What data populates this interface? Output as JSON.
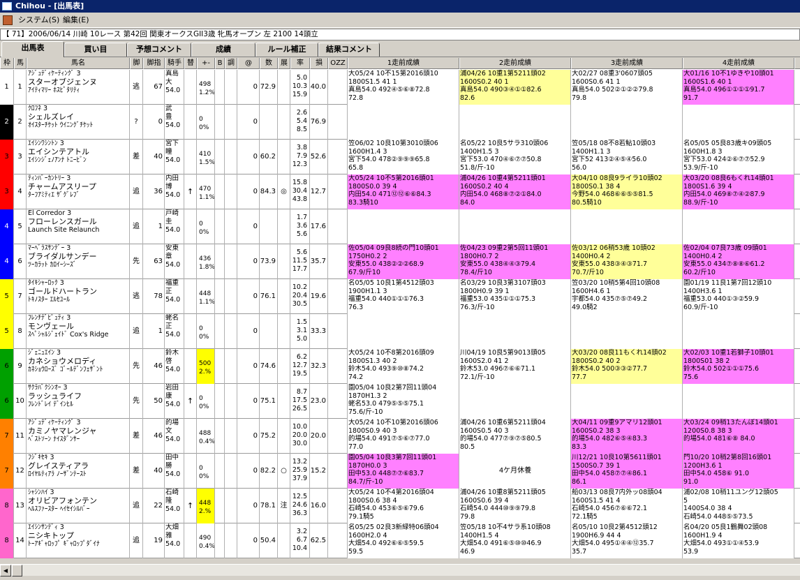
{
  "window": {
    "title": "Chihou - [出馬表]"
  },
  "menu": [
    "システム(S)",
    "編集(E)"
  ],
  "race_info": "【 71】2006/06/14 川崎 10レース 第42回 関東オークスGII3歳 牝馬オープン 左 2100 14頭立",
  "tabs": [
    "出馬表",
    "買い目",
    "予想コメント",
    "成績",
    "ルール補正",
    "結果コメント"
  ],
  "active_tab": "出馬表",
  "headers": [
    "枠",
    "馬",
    "馬名",
    "脚",
    "脚指",
    "騎手",
    "替",
    "+-",
    "B",
    "調",
    "@",
    "数",
    "展",
    "率",
    "損",
    "OZZ",
    "1走前成績",
    "2走前成績",
    "3走前成績",
    "4走前成績"
  ],
  "colors": {
    "waku1": "#ffffff",
    "waku2": "#000000",
    "waku3": "#ff0000",
    "waku4": "#0000ff",
    "waku5": "#ffff00",
    "waku6": "#00a000",
    "waku7": "#ff8000",
    "waku8": "#ff66cc",
    "pink": "#ff80ff",
    "yellow": "#ffff99"
  },
  "rows": [
    {
      "waku": "1",
      "waku_color": "#ffffff",
      "waku_text": "#000000",
      "uma": "1",
      "name": [
        "ｱｼﾞｭﾃﾞｨｹｰﾃｨﾝｸﾞ 3",
        "スターオブジェンヌ",
        "ｱｲﾃｨﾏﾘｰ ﾎｽﾋﾟﾀﾘﾃｨ"
      ],
      "ashi": "逃",
      "shisu": "67",
      "jockey": [
        "真島",
        "大",
        "54.0"
      ],
      "kae": "",
      "pm": [
        "498",
        "1.2%"
      ],
      "pm_hl": false,
      "at": "0",
      "su": "72.9",
      "ten": "",
      "ritsu": [
        "5.0",
        "10.3",
        "15.9"
      ],
      "son": "40.0",
      "past": [
        {
          "lines": [
            "大05/24 10不15第2016頭10",
            "1800S1.5 41 1",
            "真島54.0 492④⑤⑥⑧72.8",
            "72.8"
          ],
          "bg": "#ffffff"
        },
        {
          "lines": [
            "浦04/26 10重1第5211頭02",
            "1600S0.2 40 1",
            "真島54.0 490③④①①82.6",
            "82.6"
          ],
          "bg": "#ffff99"
        },
        {
          "lines": [
            "大02/27 08重3'0607頭05",
            "1600S0.6 41 1",
            "真島54.0 502②①②②79.8",
            "79.8"
          ],
          "bg": "#ffffff"
        },
        {
          "lines": [
            "大01/16 10不1ゆきや10頭01",
            "1600S1.6 40 1",
            "真島54.0 496①①①①91.7",
            "91.7"
          ],
          "bg": "#ff80ff"
        }
      ]
    },
    {
      "waku": "2",
      "waku_color": "#000000",
      "waku_text": "#ffffff",
      "uma": "2",
      "name": [
        "ｸﾛﾌﾈ 3",
        "シェルズレイ",
        "ｵｲｽﾀｰﾁｹｯﾄ ｳｲﾆﾝｸﾞﾁｹｯﾄ"
      ],
      "ashi": "?",
      "shisu": "0",
      "jockey": [
        "武",
        "豊",
        "54.0"
      ],
      "kae": "",
      "pm": [
        "0",
        "0%"
      ],
      "pm_hl": false,
      "at": "0",
      "su": "",
      "ten": "",
      "ritsu": [
        "2.6",
        "5.4",
        "8.5"
      ],
      "son": "76.9",
      "past": [
        {
          "lines": [],
          "bg": "#ffffff"
        },
        {
          "lines": [],
          "bg": "#ffffff"
        },
        {
          "lines": [],
          "bg": "#ffffff"
        },
        {
          "lines": [],
          "bg": "#ffffff"
        }
      ]
    },
    {
      "waku": "3",
      "waku_color": "#ff0000",
      "waku_text": "#000000",
      "uma": "3",
      "name": [
        "ｴｲｼﾝﾜｼﾝﾄﾝ 3",
        "エイシンテアトル",
        "ｴｲｼﾝｼﾞｪﾉｱﾝﾅ ﾄﾆｰﾋﾞﾝ"
      ],
      "ashi": "差",
      "shisu": "40",
      "jockey": [
        "宮下",
        "瞳",
        "54.0"
      ],
      "kae": "",
      "pm": [
        "410",
        "1.5%"
      ],
      "pm_hl": false,
      "at": "0",
      "su": "60.2",
      "ten": "",
      "ritsu": [
        "3.8",
        "7.9",
        "12.3"
      ],
      "son": "52.6",
      "past": [
        {
          "lines": [
            "笠06/02 10良10第3010頭06",
            "1600H1.4 3",
            "宮下54.0 478②⑨⑨⑨65.8",
            "65.8"
          ],
          "bg": "#ffffff"
        },
        {
          "lines": [
            "名05/22 10良5サラ310頭06",
            "1400H1.5 3",
            "宮下53.0 470④⑥⑦⑦50.8",
            "51.8/斤-10"
          ],
          "bg": "#ffffff"
        },
        {
          "lines": [
            "笠05/18 08不8若鮎10頭03",
            "1400H1.1 3",
            "宮下52 413②④⑤④56.0",
            "56.0"
          ],
          "bg": "#ffffff"
        },
        {
          "lines": [
            "名05/05 05良83歳キ09頭05",
            "1600H1.8 3",
            "宮下53.0 424②⑥⑦⑦52.9",
            "53.9/斤-10"
          ],
          "bg": "#ffffff"
        }
      ]
    },
    {
      "waku": "3",
      "waku_color": "#ff0000",
      "waku_text": "#000000",
      "uma": "4",
      "name": [
        "ﾃｨﾝﾊﾞｰｶﾝﾄﾘｰ 3",
        "チャームアスリープ",
        "ﾀｰﾌｱﾐﾃｨｴ ｻﾞｸﾞﾚﾌﾞ"
      ],
      "ashi": "追",
      "shisu": "36",
      "jockey": [
        "内田",
        "博",
        "54.0"
      ],
      "kae": "↑",
      "pm": [
        "470",
        "1.1%"
      ],
      "pm_hl": false,
      "at": "0",
      "su": "84.3",
      "ten": "◎",
      "ritsu": [
        "15.8",
        "30.4",
        "43.8"
      ],
      "son": "12.7",
      "past": [
        {
          "lines": [
            "大05/24 10不5第2016頭01",
            "1800S0.0 39 4",
            "内田54.0 471⑫⑫⑥⑥84.3",
            "83.3騎10"
          ],
          "bg": "#ff80ff"
        },
        {
          "lines": [
            "浦04/26 10重4第5211頭01",
            "1600S0.2 40 4",
            "内田54.0 468⑧⑦②①84.0",
            "84.0"
          ],
          "bg": "#ff80ff"
        },
        {
          "lines": [
            "大04/10 08良9ライラ10頭02",
            "1800S0.1 38 4",
            "今野54.0 468⑥⑥⑤⑤81.5",
            "80.5騎10"
          ],
          "bg": "#ffff99"
        },
        {
          "lines": [
            "大03/20 08良6もくれ14頭01",
            "1800S1.6 39 4",
            "内田54.0 469⑧⑦④②87.9",
            "88.9/斤-10"
          ],
          "bg": "#ff80ff"
        }
      ]
    },
    {
      "waku": "4",
      "waku_color": "#0000ff",
      "waku_text": "#ffffff",
      "uma": "5",
      "name": [
        "El Corredor 3",
        "フローレンスガール",
        "Launch Site Relaunch"
      ],
      "ashi": "追",
      "shisu": "1",
      "jockey": [
        "戸崎",
        "圭",
        "54.0"
      ],
      "kae": "",
      "pm": [
        "0",
        "0%"
      ],
      "pm_hl": false,
      "at": "0",
      "su": "",
      "ten": "",
      "ritsu": [
        "1.7",
        "3.6",
        "5.6"
      ],
      "son": "17.6",
      "past": [
        {
          "lines": [],
          "bg": "#ffffff"
        },
        {
          "lines": [],
          "bg": "#ffffff"
        },
        {
          "lines": [],
          "bg": "#ffffff"
        },
        {
          "lines": [],
          "bg": "#ffffff"
        }
      ]
    },
    {
      "waku": "4",
      "waku_color": "#0000ff",
      "waku_text": "#ffffff",
      "uma": "6",
      "name": [
        "ﾏｰﾍﾞﾗｽｻﾝﾃﾞｰ 3",
        "ブライダルサンデー",
        "ﾂｰｶﾗｯﾄ ｶﾛｲｰｼｰｽﾞ"
      ],
      "ashi": "先",
      "shisu": "63",
      "jockey": [
        "安東",
        "章",
        "54.0"
      ],
      "kae": "",
      "pm": [
        "436",
        "1.8%"
      ],
      "pm_hl": false,
      "at": "0",
      "su": "73.9",
      "ten": "",
      "ritsu": [
        "5.6",
        "11.5",
        "17.7"
      ],
      "son": "35.7",
      "past": [
        {
          "lines": [
            "佐05/04 09良8続の門10頭01",
            "1750H0.2 2",
            "安東55.0 438②②②68.9",
            "67.9/斤10"
          ],
          "bg": "#ff80ff"
        },
        {
          "lines": [
            "佐04/23 09重2第5回11頭01",
            "1800H0.7 2",
            "安東55.0 438④④③79.4",
            "78.4/斤10"
          ],
          "bg": "#ff80ff"
        },
        {
          "lines": [
            "佐03/12 06稍53歳 10頭02",
            "1400H0.4 2",
            "安東55.0 438③④③71.7",
            "70.7/斤10"
          ],
          "bg": "#ffff99"
        },
        {
          "lines": [
            "佐02/04 07良73歳 09頭01",
            "1400H0.4 2",
            "安東55.0 434⑦⑧⑧⑥61.2",
            "60.2/斤10"
          ],
          "bg": "#ff80ff"
        }
      ]
    },
    {
      "waku": "5",
      "waku_color": "#ffff00",
      "waku_text": "#000000",
      "uma": "7",
      "name": [
        "ﾀｲｷｼｬｰﾛｯｸ 3",
        "ゴールドハートラン",
        "ﾄｷﾉｽﾀｰ ｴﾙｾﾕｰﾙ"
      ],
      "ashi": "逃",
      "shisu": "78",
      "jockey": [
        "福重",
        "正",
        "54.0"
      ],
      "kae": "",
      "pm": [
        "448",
        "1.1%"
      ],
      "pm_hl": false,
      "at": "0",
      "su": "76.1",
      "ten": "",
      "ritsu": [
        "10.2",
        "20.4",
        "30.5"
      ],
      "son": "19.6",
      "past": [
        {
          "lines": [
            "名05/05 10良1第4512頭03",
            "1900H1.1 3",
            "福重54.0 440①①①76.3",
            "76.3"
          ],
          "bg": "#ffffff"
        },
        {
          "lines": [
            "名03/29 10良3第3107頭03",
            "1800H0.9 39 1",
            "福重53.0 435①①①75.3",
            "76.3/斤-10"
          ],
          "bg": "#ffffff"
        },
        {
          "lines": [
            "笠03/20 10稍5第4回10頭08",
            "1600H4.6 1",
            "宇都54.0 435⑦⑤⑦49.2",
            "49.0騎2"
          ],
          "bg": "#ffffff"
        },
        {
          "lines": [
            "園01/19 11良1第7回12頭10",
            "1400H3.6 1",
            "福重53.0 440①③②59.9",
            "60.9/斤-10"
          ],
          "bg": "#ffffff"
        }
      ]
    },
    {
      "waku": "5",
      "waku_color": "#ffff00",
      "waku_text": "#000000",
      "uma": "8",
      "name": [
        "ﾌﾚﾝﾁﾃﾞﾋﾟｭﾃｨ 3",
        "モンヴェール",
        "ｽﾍﾟｼｬﾙｼﾞｪｲﾄﾞ Cox's Ridge"
      ],
      "ashi": "追",
      "shisu": "1",
      "jockey": [
        "蛯名",
        "正",
        "54.0"
      ],
      "kae": "",
      "pm": [
        "0",
        "0%"
      ],
      "pm_hl": false,
      "at": "0",
      "su": "",
      "ten": "",
      "ritsu": [
        "1.5",
        "3.1",
        "5.0"
      ],
      "son": "33.3",
      "past": [
        {
          "lines": [],
          "bg": "#ffffff"
        },
        {
          "lines": [],
          "bg": "#ffffff"
        },
        {
          "lines": [],
          "bg": "#ffffff"
        },
        {
          "lines": [],
          "bg": "#ffffff"
        }
      ]
    },
    {
      "waku": "6",
      "waku_color": "#00a000",
      "waku_text": "#000000",
      "uma": "9",
      "name": [
        "ｼﾞｪﾆｭｴｲﾝ 3",
        "カネショウメロディ",
        "ｶﾈｼｮｳﾛｰｽﾞ ｺﾞｰﾙﾃﾞﾝﾌｪｻﾞﾝﾄ"
      ],
      "ashi": "先",
      "shisu": "46",
      "jockey": [
        "鈴木",
        "啓",
        "54.0"
      ],
      "kae": "",
      "pm": [
        "500",
        "2.%"
      ],
      "pm_hl": true,
      "at": "0",
      "su": "74.6",
      "ten": "",
      "ritsu": [
        "6.2",
        "12.7",
        "19.5"
      ],
      "son": "32.3",
      "past": [
        {
          "lines": [
            "大05/24 10不8第2016頭09",
            "1800S1.3 40 2",
            "鈴木54.0 493⑨⑩⑧74.2",
            "74.2"
          ],
          "bg": "#ffffff"
        },
        {
          "lines": [
            "川04/19 10良5第9013頭05",
            "1600S2.0 41 2",
            "鈴木53.0 496⑦⑥⑥71.1",
            "72.1/斤-10"
          ],
          "bg": "#ffffff"
        },
        {
          "lines": [
            "大03/20 08良11もくれ14頭02",
            "1800S0.2 40 2",
            "鈴木54.0 500③③②77.7",
            "77.7"
          ],
          "bg": "#ffff99"
        },
        {
          "lines": [
            "大02/03 10重1若獅子10頭01",
            "1800S01 38 2",
            "鈴木54.0 502①①①75.6",
            "75.6"
          ],
          "bg": "#ff80ff"
        }
      ]
    },
    {
      "waku": "6",
      "waku_color": "#00a000",
      "waku_text": "#000000",
      "uma": "10",
      "name": [
        "ｻｸﾗﾊﾞｸｼﾝｵｰ 3",
        "ラッシュライフ",
        "ﾌﾚﾝﾄﾞﾚｲ ﾃﾞｲﾝﾋﾙ"
      ],
      "ashi": "先",
      "shisu": "50",
      "jockey": [
        "岩田",
        "康",
        "54.0"
      ],
      "kae": "↑",
      "pm": [
        "0",
        "0%"
      ],
      "pm_hl": false,
      "at": "0",
      "su": "75.1",
      "ten": "",
      "ritsu": [
        "8.7",
        "17.5",
        "26.5"
      ],
      "son": "23.0",
      "past": [
        {
          "lines": [
            "園05/04 10良2第7回11頭04",
            "1870H1.3 2",
            "蛯名53.0 479⑤⑤⑤75.1",
            "75.6/斤-10"
          ],
          "bg": "#ffffff"
        },
        {
          "lines": [],
          "bg": "#ffffff"
        },
        {
          "lines": [],
          "bg": "#ffffff"
        },
        {
          "lines": [],
          "bg": "#ffffff"
        }
      ]
    },
    {
      "waku": "7",
      "waku_color": "#ff8000",
      "waku_text": "#000000",
      "uma": "11",
      "name": [
        "ｱｼﾞｭﾃﾞｨｹｰﾃｨﾝｸﾞ 3",
        "カミノヤマレンジャ",
        "ﾍﾞｽﾄｿｰﾝ ﾅｲｽﾀﾞﾝｻｰ"
      ],
      "ashi": "差",
      "shisu": "46",
      "jockey": [
        "的場",
        "文",
        "54.0"
      ],
      "kae": "",
      "pm": [
        "488",
        "0.4%"
      ],
      "pm_hl": false,
      "at": "0",
      "su": "75.2",
      "ten": "",
      "ritsu": [
        "10.0",
        "20.0",
        "30.0"
      ],
      "son": "20.0",
      "past": [
        {
          "lines": [
            "大05/24 10不10第2016頭06",
            "1800S0.9 40 3",
            "的場54.0 491⑦⑤⑥⑦77.0",
            "77.0"
          ],
          "bg": "#ffffff"
        },
        {
          "lines": [
            "浦04/26 10重6第5211頭04",
            "1600S0.5 40 3",
            "的場54.0 477⑦⑨⑦⑤80.5",
            "80.5"
          ],
          "bg": "#ffffff"
        },
        {
          "lines": [
            "大04/11 09重9アマリ12頭01",
            "1600S0.2 38 3",
            "的場54.0 482⑥⑤④83.3",
            "83.3"
          ],
          "bg": "#ff80ff"
        },
        {
          "lines": [
            "大03/24 09稍13たんぽ14頭01",
            "1200S0.8 38 3",
            "的場54.0 481⑥⑧ 84.0",
            ""
          ],
          "bg": "#ff80ff"
        }
      ]
    },
    {
      "waku": "7",
      "waku_color": "#ff8000",
      "waku_text": "#000000",
      "uma": "12",
      "name": [
        "ﾌｼﾞｷｾｷ 3",
        "グレイスティアラ",
        "ﾛｲﾔﾙﾃｨｱﾗ ﾉｰｻﾞﾝﾃｰｽﾄ"
      ],
      "ashi": "差",
      "shisu": "40",
      "jockey": [
        "田中",
        "勝",
        "54.0"
      ],
      "kae": "",
      "pm": [
        "0",
        "0%"
      ],
      "pm_hl": false,
      "at": "0",
      "su": "82.2",
      "ten": "○",
      "ritsu": [
        "13.2",
        "25.9",
        "37.9"
      ],
      "son": "15.2",
      "past": [
        {
          "lines": [
            "園05/04 10良3第7回11頭01",
            "1870H0.0 3",
            "田中53.0 448⑦⑦⑥83.7",
            "84.7/斤-10"
          ],
          "bg": "#ff80ff"
        },
        {
          "lines": [
            "4ケ月休養"
          ],
          "bg": "#ffffff",
          "single": true
        },
        {
          "lines": [
            "川12/21 10良10第5611頭01",
            "1500S0.7 39 1",
            "田中54.0 458⑦⑦④86.1",
            "86.1"
          ],
          "bg": "#ff80ff"
        },
        {
          "lines": [
            "門10/20 10稍2第8回16頭01",
            "1200H3.6 1",
            "田中54.0 458⑥ 91.0",
            "91.0"
          ],
          "bg": "#ff80ff"
        }
      ]
    },
    {
      "waku": "8",
      "waku_color": "#ff66cc",
      "waku_text": "#000000",
      "uma": "13",
      "name": [
        "ｼｬｼﾝﾊｲ 3",
        "オリビアフォンテン",
        "ﾍﾙｽﾌｧｰｽﾀｰ ﾍｲｾｲｼﾙﾊﾞｰ"
      ],
      "ashi": "追",
      "shisu": "22",
      "jockey": [
        "石崎",
        "隆",
        "54.0"
      ],
      "kae": "↑",
      "pm": [
        "448",
        "2.%"
      ],
      "pm_hl": true,
      "at": "0",
      "su": "78.1",
      "ten": "注",
      "ritsu": [
        "12.5",
        "24.6",
        "36.3"
      ],
      "son": "16.0",
      "past": [
        {
          "lines": [
            "大05/24 10不4第2016頭04",
            "1800S0.6 38 4",
            "石崎54.0 453⑥⑤⑥79.6",
            "79.1騎5"
          ],
          "bg": "#ffffff"
        },
        {
          "lines": [
            "浦04/26 10重8第5211頭05",
            "1600S0.6 39 4",
            "石崎54.0 444⑩⑨⑨79.8",
            "79.8"
          ],
          "bg": "#ffffff"
        },
        {
          "lines": [
            "船03/13 08良7内外ッ08頭04",
            "1600S1.5 41 4",
            "石崎54.0 456⑦⑥⑥72.1",
            "72.1騎5"
          ],
          "bg": "#ffffff"
        },
        {
          "lines": [
            "浦02/08 10稍11ユング12頭05",
            "5",
            "1400S4.0 38 4",
            "石崎54.0 448⑤⑤73.5"
          ],
          "bg": "#ffffff"
        }
      ]
    },
    {
      "waku": "8",
      "waku_color": "#ff66cc",
      "waku_text": "#000000",
      "uma": "14",
      "name": [
        "ｴｲｼﾝｻﾝﾃﾞｨ 3",
        "ニシキトップ",
        "ﾄｰｱｷﾞｬﾛｯﾌﾟ ｷﾞｬﾛｯﾌﾟﾀﾞｲﾅ"
      ],
      "ashi": "追",
      "shisu": "19",
      "jockey": [
        "大畑",
        "雅",
        "54.0"
      ],
      "kae": "",
      "pm": [
        "490",
        "0.4%"
      ],
      "pm_hl": false,
      "at": "0",
      "su": "50.4",
      "ten": "",
      "ritsu": [
        "3.2",
        "6.7",
        "10.4"
      ],
      "son": "62.5",
      "past": [
        {
          "lines": [
            "名05/25 02良3新緑特06頭04",
            "1600H2.0 4",
            "大畑54.0 492⑥⑥⑤59.5",
            "59.5"
          ],
          "bg": "#ffffff"
        },
        {
          "lines": [
            "笠05/18 10不4サラ系10頭08",
            "1400H1.5 4",
            "大畑54.0 491⑥⑤⑩⑩46.9",
            "46.9"
          ],
          "bg": "#ffffff"
        },
        {
          "lines": [
            "名05/10 10良2第4512頭12",
            "1900H6.9 44 4",
            "大畑54.0 495①④④⑫35.7",
            "35.7"
          ],
          "bg": "#ffffff"
        },
        {
          "lines": [
            "名04/20 05良1鶴舞02頭08",
            "1600H1.9 4",
            "大畑54.0 493①①④53.9",
            "53.9"
          ],
          "bg": "#ffffff"
        }
      ]
    }
  ]
}
